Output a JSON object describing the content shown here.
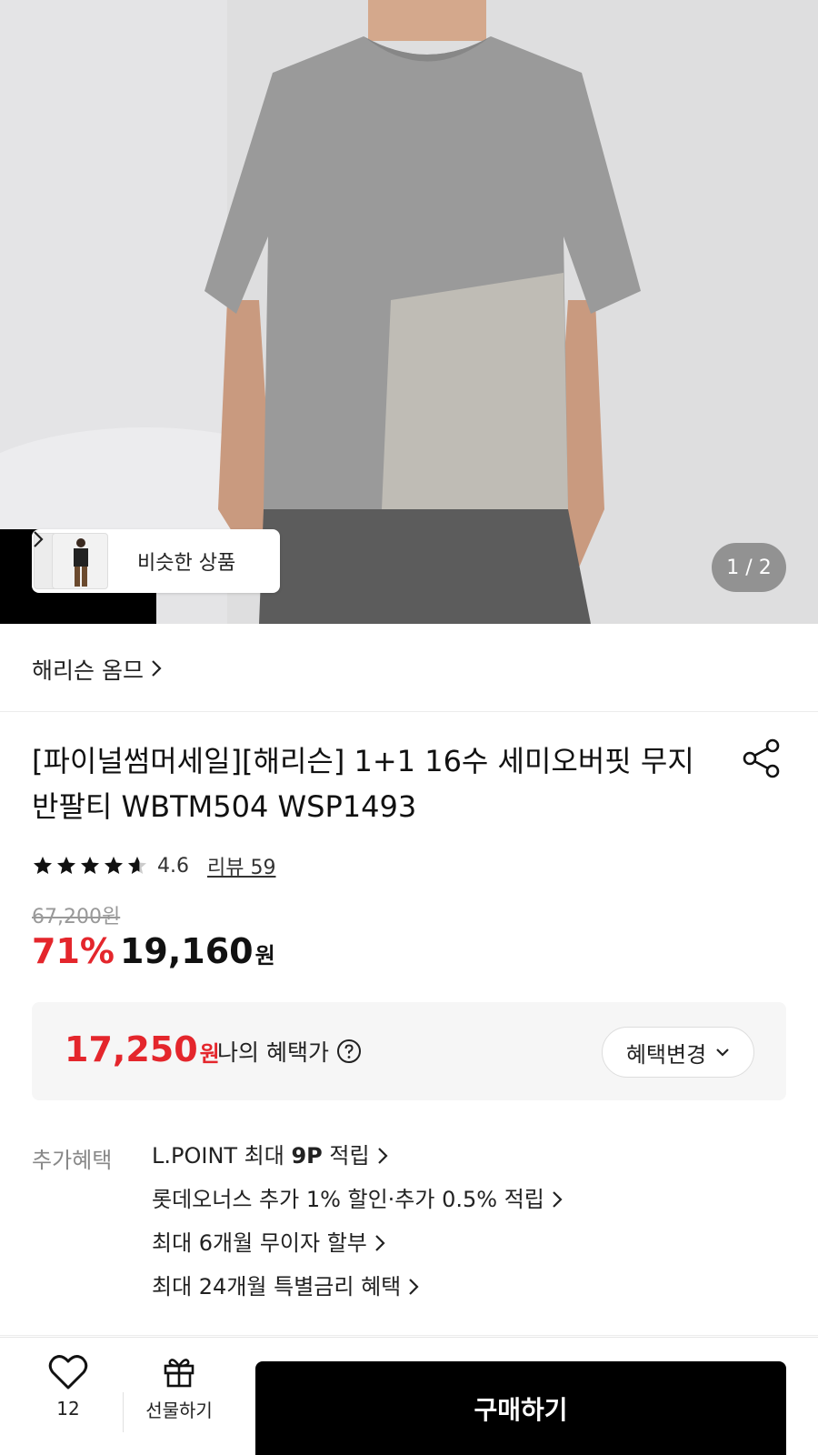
{
  "hero": {
    "similar_label": "비슷한 상품",
    "page_indicator": "1 / 2"
  },
  "brand": {
    "name": "해리슨 옴므"
  },
  "product": {
    "title": "[파이널썸머세일][해리슨] 1+1 16수 세미오버핏 무지 반팔티 WBTM504 WSP1493",
    "rating": "4.6",
    "rating_stars": 4.6,
    "review_link": "리뷰 59",
    "original_price": "67,200원",
    "discount": "71%",
    "sale_price": "19,160",
    "currency": "원"
  },
  "benefit": {
    "amount": "17,250",
    "currency": "원",
    "label": "나의 혜택가",
    "change_button": "혜택변경"
  },
  "extra": {
    "label": "추가혜택",
    "items": [
      {
        "pre": "L.POINT 최대 ",
        "bold": "9P",
        "post": " 적립"
      },
      {
        "pre": "롯데오너스 추가 1% 할인·추가 0.5% 적립",
        "bold": "",
        "post": ""
      },
      {
        "pre": "최대 6개월 무이자 할부",
        "bold": "",
        "post": ""
      },
      {
        "pre": "최대 24개월 특별금리 혜택",
        "bold": "",
        "post": ""
      }
    ]
  },
  "bottom": {
    "wish_count": "12",
    "gift_label": "선물하기",
    "buy_label": "구매하기"
  },
  "colors": {
    "accent_red": "#e4262c",
    "buy_button": "#000000"
  },
  "icons": [
    "chevron-right-icon",
    "share-icon",
    "star-icon",
    "help-icon",
    "chevron-down-icon",
    "heart-icon",
    "gift-icon"
  ]
}
